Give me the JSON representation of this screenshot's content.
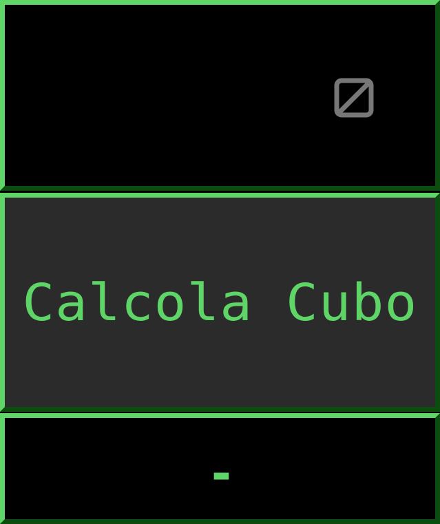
{
  "input": {
    "value": "",
    "clear_icon": "clear-input-icon"
  },
  "action": {
    "label": "Calcola Cubo"
  },
  "output": {
    "value": "-"
  },
  "colors": {
    "accent": "#5fd467",
    "border_dark": "#0b4d0e",
    "button_bg": "#2b2b2b",
    "background": "#000000",
    "icon_gray": "#777777"
  }
}
